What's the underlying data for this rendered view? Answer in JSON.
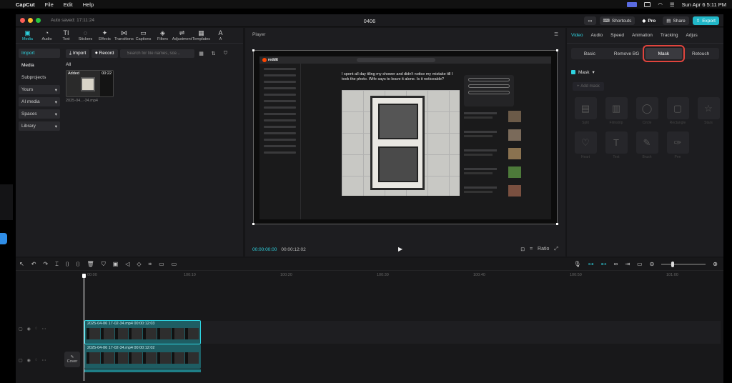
{
  "menubar": {
    "app": "CapCut",
    "items": [
      "File",
      "Edit",
      "Help"
    ],
    "clock": "Sun Apr 6  5:11 PM"
  },
  "window": {
    "autosave": "Auto saved: 17:11:24",
    "title": "0406",
    "shortcuts": "Shortcuts",
    "pro": "Pro",
    "share": "Share",
    "export": "Export"
  },
  "media": {
    "tools": [
      {
        "icon": "▣",
        "label": "Media"
      },
      {
        "icon": "◔",
        "label": "Audio"
      },
      {
        "icon": "TI",
        "label": "Text"
      },
      {
        "icon": "◌",
        "label": "Stickers"
      },
      {
        "icon": "✦",
        "label": "Effects"
      },
      {
        "icon": "⋈",
        "label": "Transitions"
      },
      {
        "icon": "▭",
        "label": "Captions"
      },
      {
        "icon": "◈",
        "label": "Filters"
      },
      {
        "icon": "⇌",
        "label": "Adjustment"
      },
      {
        "icon": "▦",
        "label": "Templates"
      },
      {
        "icon": "A",
        "label": "A"
      }
    ],
    "nav": {
      "import": "Import",
      "media": "Media",
      "subprojects": "Subprojects",
      "yours": "Yours",
      "ai_media": "AI media",
      "spaces": "Spaces",
      "library": "Library"
    },
    "import_btn": "Import",
    "record_btn": "Record",
    "search_placeholder": "Search for file names, sce...",
    "all_label": "All",
    "thumb": {
      "added": "Added",
      "duration": "00:22",
      "name": "2025-04...-34.mp4"
    }
  },
  "player": {
    "label": "Player",
    "current_time": "00:00:00:00",
    "total_time": "00:00:12:02",
    "ratio": "Ratio",
    "reddit_logo_text": "reddit",
    "post_title": "I spent all day tiling my shower and didn't notice my mistake till I took the photo. Wife says to leave it alone. Is it noticeable?"
  },
  "props": {
    "tabs": [
      "Video",
      "Audio",
      "Speed",
      "Animation",
      "Tracking",
      "Adjus"
    ],
    "subtabs": [
      "Basic",
      "Remove BG",
      "Mask",
      "Retouch"
    ],
    "mask_title": "Mask",
    "add_mask": "Add mask",
    "shapes": [
      {
        "icon": "▤",
        "label": "Split"
      },
      {
        "icon": "▥",
        "label": "Filmstrip"
      },
      {
        "icon": "◯",
        "label": "Circle"
      },
      {
        "icon": "▢",
        "label": "Rectangle"
      },
      {
        "icon": "☆",
        "label": "Stars"
      },
      {
        "icon": "♡",
        "label": "Heart"
      },
      {
        "icon": "T",
        "label": "Text"
      },
      {
        "icon": "✎",
        "label": "Brush"
      },
      {
        "icon": "✑",
        "label": "Pen"
      }
    ]
  },
  "timeline": {
    "ruler": [
      "00:00",
      "100:10",
      "100:20",
      "100:30",
      "100:40",
      "100:50",
      "101:00"
    ],
    "clip_top_label": "2025-04-06 17-02-34.mp4  00:00:12:03",
    "clip_main_label": "2025-04-06 17-02-34.mp4  00:00:12:02",
    "cover": "Cover"
  }
}
